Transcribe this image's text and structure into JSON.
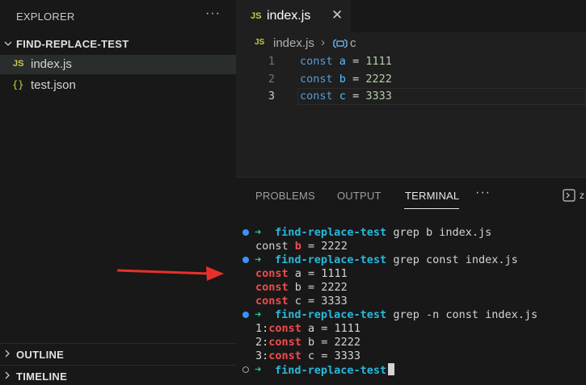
{
  "explorer": {
    "title": "EXPLORER",
    "more": "···",
    "folder": "FIND-REPLACE-TEST",
    "files": [
      {
        "icon": "JS",
        "name": "index.js"
      },
      {
        "icon": "{}",
        "name": "test.json"
      }
    ],
    "outline": "OUTLINE",
    "timeline": "TIMELINE"
  },
  "editor": {
    "tab": {
      "icon": "JS",
      "label": "index.js",
      "close": "✕"
    },
    "breadcrumb": {
      "file": "index.js",
      "sep": "›",
      "symbol": "c"
    },
    "lines": [
      {
        "num": "1",
        "kw": "const",
        "var": "a",
        "op": "=",
        "val": "1111"
      },
      {
        "num": "2",
        "kw": "const",
        "var": "b",
        "op": "=",
        "val": "2222"
      },
      {
        "num": "3",
        "kw": "const",
        "var": "c",
        "op": "=",
        "val": "3333"
      }
    ]
  },
  "panel": {
    "tabs": [
      "PROBLEMS",
      "OUTPUT",
      "TERMINAL"
    ],
    "active_tab": "TERMINAL",
    "more": "···",
    "cut_label": "z"
  },
  "terminal": {
    "arrow": "➜",
    "dir": "find-replace-test",
    "cmd1": "grep b index.js",
    "out1": {
      "pre": "const ",
      "hit": "b",
      "post": " = 2222"
    },
    "cmd2": "grep const index.js",
    "out2": [
      {
        "hit": "const",
        "post": " a = 1111"
      },
      {
        "hit": "const",
        "post": " b = 2222"
      },
      {
        "hit": "const",
        "post": " c = 3333"
      }
    ],
    "cmd3": "grep -n const index.js",
    "out3": [
      {
        "pre": "1:",
        "hit": "const",
        "post": " a = 1111"
      },
      {
        "pre": "2:",
        "hit": "const",
        "post": " b = 2222"
      },
      {
        "pre": "3:",
        "hit": "const",
        "post": " c = 3333"
      }
    ]
  },
  "colors": {
    "annotation_arrow": "#e8302a",
    "prompt_dot": "#3794ff",
    "match": "#f14c4c"
  }
}
